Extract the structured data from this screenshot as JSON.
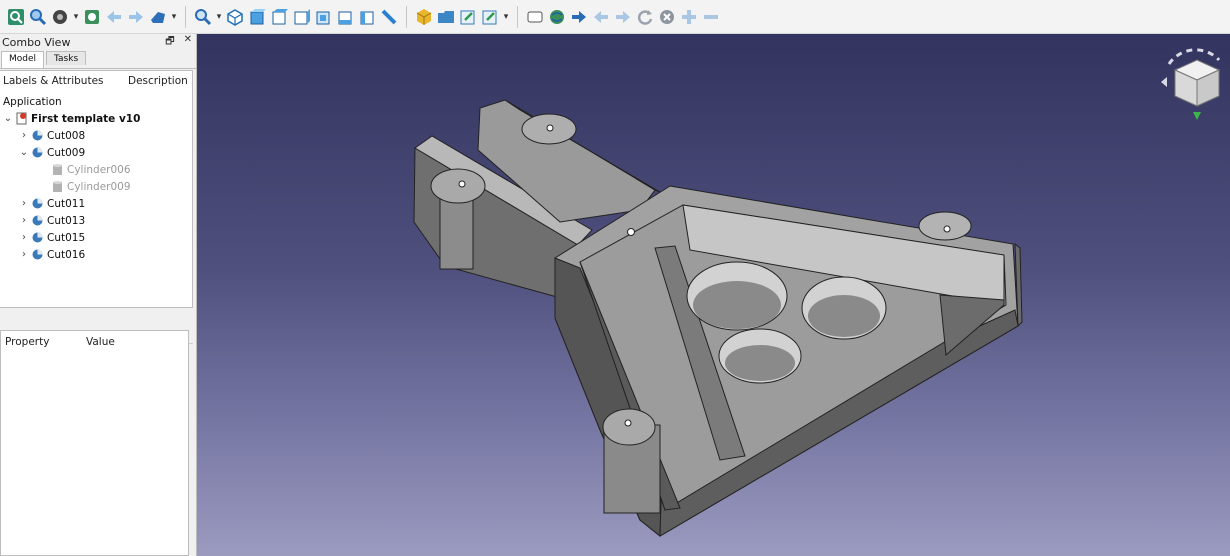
{
  "toolbar": {
    "icons": [
      "fit-all",
      "zoom",
      "draw-style",
      "std-views",
      "back",
      "forward",
      "workbench",
      "box-zoom",
      "isometric",
      "front",
      "top",
      "right",
      "rear",
      "bottom",
      "left",
      "measure",
      "part",
      "folder",
      "link",
      "link-actions",
      "sketch",
      "globe",
      "arrow-right",
      "nav-back",
      "nav-fwd",
      "refresh",
      "stop",
      "add",
      "remove"
    ]
  },
  "combo": {
    "title": "Combo View",
    "tabs": [
      "Model",
      "Tasks"
    ]
  },
  "tree": {
    "col_labels": "Labels & Attributes",
    "col_desc": "Description",
    "root": "Application",
    "document": "First template v10",
    "items": [
      {
        "label": "Cut008"
      },
      {
        "label": "Cut009"
      },
      {
        "label": "Cylinder006"
      },
      {
        "label": "Cylinder009"
      },
      {
        "label": "Cut011"
      },
      {
        "label": "Cut013"
      },
      {
        "label": "Cut015"
      },
      {
        "label": "Cut016"
      }
    ]
  },
  "props": {
    "col_property": "Property",
    "col_value": "Value"
  },
  "colors": {
    "model_face": "#a3a3a3",
    "model_side": "#6a6a6a",
    "model_top": "#bdbdbd",
    "background_top": "#33335f",
    "background_bottom": "#9b9bc0"
  }
}
